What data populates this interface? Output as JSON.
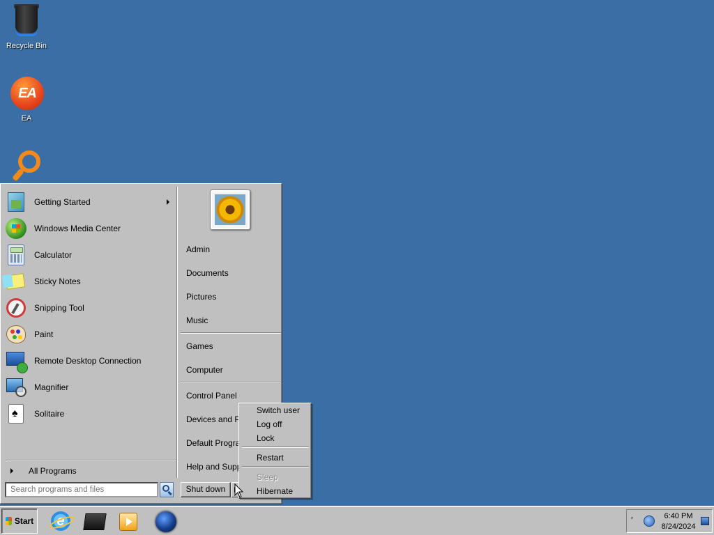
{
  "desktop": {
    "icons": [
      {
        "label": "Recycle Bin",
        "icon": "recycle-bin-icon"
      },
      {
        "label": "EA",
        "icon": "ea-logo-icon",
        "logo_text": "EA"
      },
      {
        "label": "",
        "icon": "magnifier-search-icon"
      }
    ],
    "background_color": "#3a6ea5"
  },
  "start_menu": {
    "programs": [
      {
        "label": "Getting Started",
        "icon": "getting-started-icon",
        "has_submenu": true
      },
      {
        "label": "Windows Media Center",
        "icon": "windows-media-center-icon"
      },
      {
        "label": "Calculator",
        "icon": "calculator-icon"
      },
      {
        "label": "Sticky Notes",
        "icon": "sticky-notes-icon"
      },
      {
        "label": "Snipping Tool",
        "icon": "snipping-tool-icon"
      },
      {
        "label": "Paint",
        "icon": "paint-icon"
      },
      {
        "label": "Remote Desktop Connection",
        "icon": "remote-desktop-icon"
      },
      {
        "label": "Magnifier",
        "icon": "magnifier-icon"
      },
      {
        "label": "Solitaire",
        "icon": "solitaire-icon"
      }
    ],
    "all_programs": "All Programs",
    "search_placeholder": "Search programs and files",
    "right_items": {
      "user": "Admin",
      "documents": "Documents",
      "pictures": "Pictures",
      "music": "Music",
      "games": "Games",
      "computer": "Computer",
      "control_panel": "Control Panel",
      "devices": "Devices and Printers",
      "default_programs": "Default Programs",
      "help": "Help and Support"
    },
    "shutdown_label": "Shut down"
  },
  "power_menu": {
    "switch_user": "Switch user",
    "log_off": "Log off",
    "lock": "Lock",
    "restart": "Restart",
    "sleep": "Sleep",
    "hibernate": "Hibernate",
    "disabled_items": [
      "Sleep"
    ]
  },
  "taskbar": {
    "start_label": "Start",
    "pinned": [
      "internet-explorer-icon",
      "folder-icon",
      "media-player-icon",
      "globe-icon"
    ],
    "tray": {
      "chevron": "˄",
      "time": "6:40 PM",
      "date": "8/24/2024"
    }
  }
}
